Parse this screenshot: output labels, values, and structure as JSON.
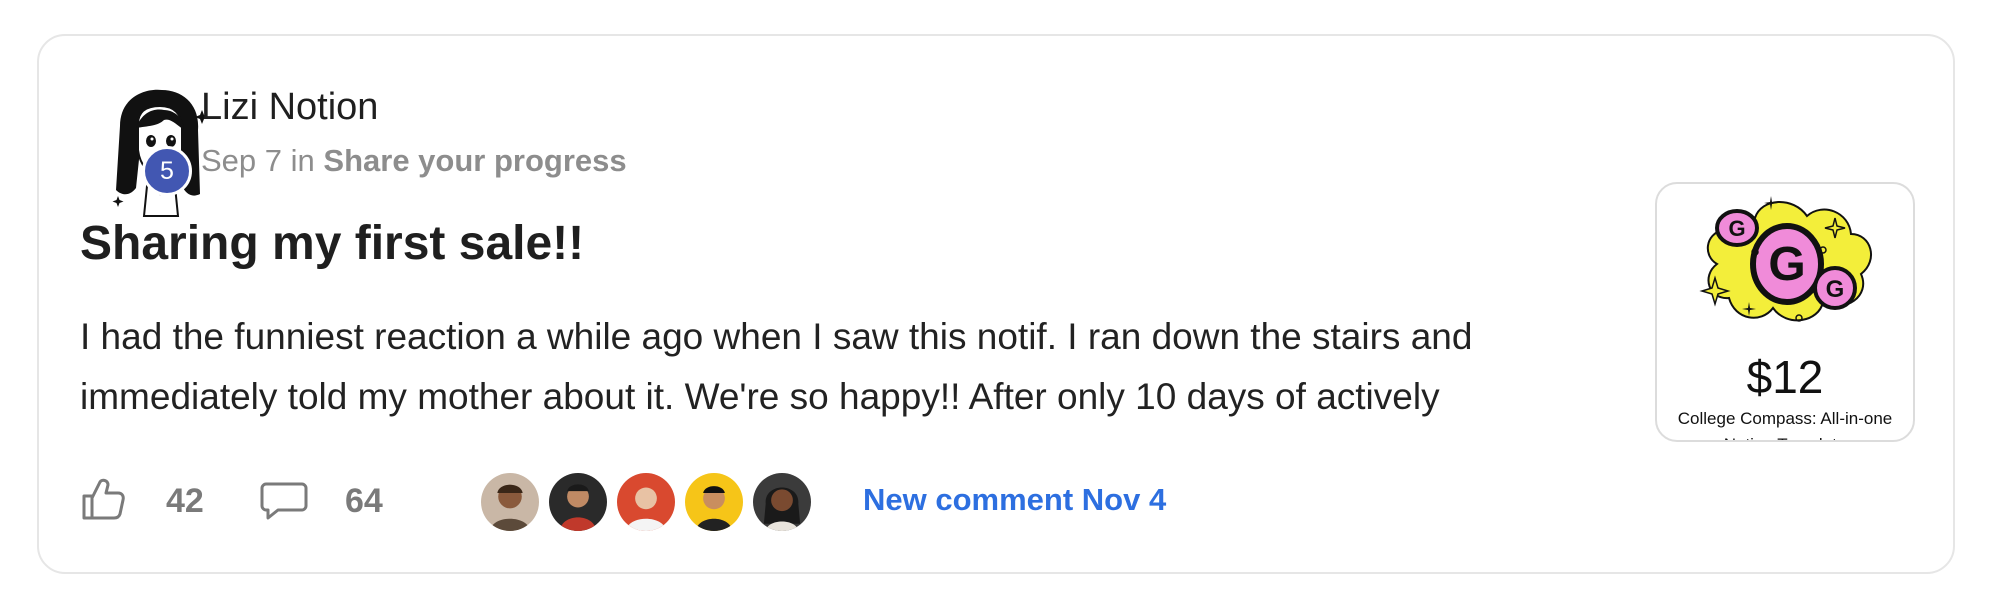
{
  "post": {
    "author": "Lizi Notion",
    "level": "5",
    "date": "Sep 7",
    "in_label": "in",
    "category": "Share your progress",
    "title": "Sharing my first sale!!",
    "body": "I had the funniest reaction a while ago when I saw this notif. I ran down the stairs and immediately told my mother about it. We're so happy!! After only 10 days of actively"
  },
  "product": {
    "price": "$12",
    "name": "College Compass: All-in-one Notion Template"
  },
  "actions": {
    "likes": "42",
    "comments": "64",
    "new_comment": "New comment Nov 4"
  },
  "icons": {
    "like": "thumbs-up-icon",
    "comment": "comment-bubble-icon"
  },
  "colors": {
    "badge": "#4257b2",
    "link": "#2d6fe0",
    "product_yellow": "#f3ee3a",
    "product_pink": "#f08bd9"
  }
}
